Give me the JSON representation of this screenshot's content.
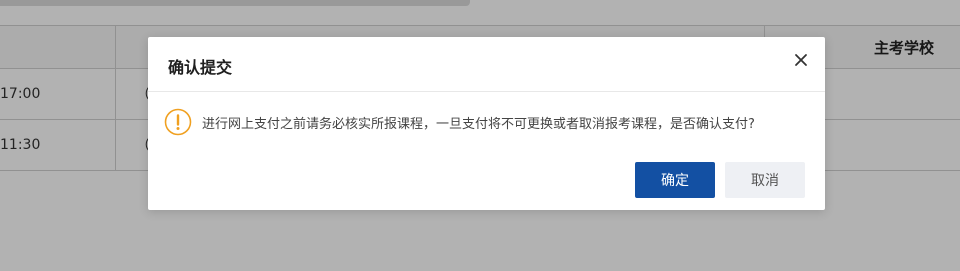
{
  "background_table": {
    "header": {
      "col3": "主考学校"
    },
    "rows": [
      {
        "time": "17:00",
        "col2": "（"
      },
      {
        "time": "11:30",
        "col2": "（"
      }
    ]
  },
  "dialog": {
    "title": "确认提交",
    "close_icon": "close-icon",
    "warning_icon": "warning-circle-icon",
    "message": "进行网上支付之前请务必核实所报课程，一旦支付将不可更换或者取消报考课程，是否确认支付?",
    "ok_label": "确定",
    "cancel_label": "取消"
  },
  "colors": {
    "primary": "#1350a3",
    "warning": "#f0a020",
    "overlay": "rgba(0,0,0,0.30)"
  }
}
